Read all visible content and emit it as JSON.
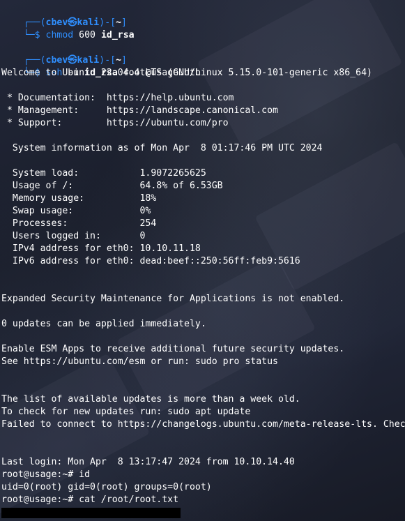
{
  "prompt": {
    "user": "cbev",
    "symbol": "㉿",
    "host": "kali",
    "dir": "~"
  },
  "commands": {
    "c1_bin": "chmod",
    "c1_args": " 600 ",
    "c1_file": "id_rsa",
    "c2_bin": "ssh",
    "c2_flag": " -i ",
    "c2_key": "id_rsa",
    "c2_target": " root@usage.htb"
  },
  "output": {
    "welcome": "Welcome to Ubuntu 22.04.4 LTS (GNU/Linux 5.15.0-101-generic x86_64)",
    "documentation": " * Documentation:  https://help.ubuntu.com",
    "management": " * Management:     https://landscape.canonical.com",
    "support": " * Support:        https://ubuntu.com/pro",
    "sysinfo": "  System information as of Mon Apr  8 01:17:46 PM UTC 2024",
    "load": "  System load:           1.9072265625",
    "usage": "  Usage of /:            64.8% of 6.53GB",
    "memory": "  Memory usage:          18%",
    "swap": "  Swap usage:            0%",
    "processes": "  Processes:             254",
    "users": "  Users logged in:       0",
    "ipv4": "  IPv4 address for eth0: 10.10.11.18",
    "ipv6": "  IPv6 address for eth0: dead:beef::250:56ff:feb9:5616",
    "esm": "Expanded Security Maintenance for Applications is not enabled.",
    "updates": "0 updates can be applied immediately.",
    "esm_apps": "Enable ESM Apps to receive additional future security updates.",
    "esm_see": "See https://ubuntu.com/esm or run: sudo pro status",
    "list_old": "The list of available updates is more than a week old.",
    "check": "To check for new updates run: sudo apt update",
    "failed": "Failed to connect to https://changelogs.ubuntu.com/meta-release-lts. Check your Internet connection or proxy settings",
    "last_login": "Last login: Mon Apr  8 13:17:47 2024 from 10.10.14.40",
    "root_id_prompt": "root@usage:~# id",
    "id_out": "uid=0(root) gid=0(root) groups=0(root)",
    "root_cat_prompt": "root@usage:~# cat /root/root.txt"
  },
  "colors": {
    "prompt_blue": "#2f8fff",
    "text": "#ffffff",
    "redaction": "#000000"
  }
}
